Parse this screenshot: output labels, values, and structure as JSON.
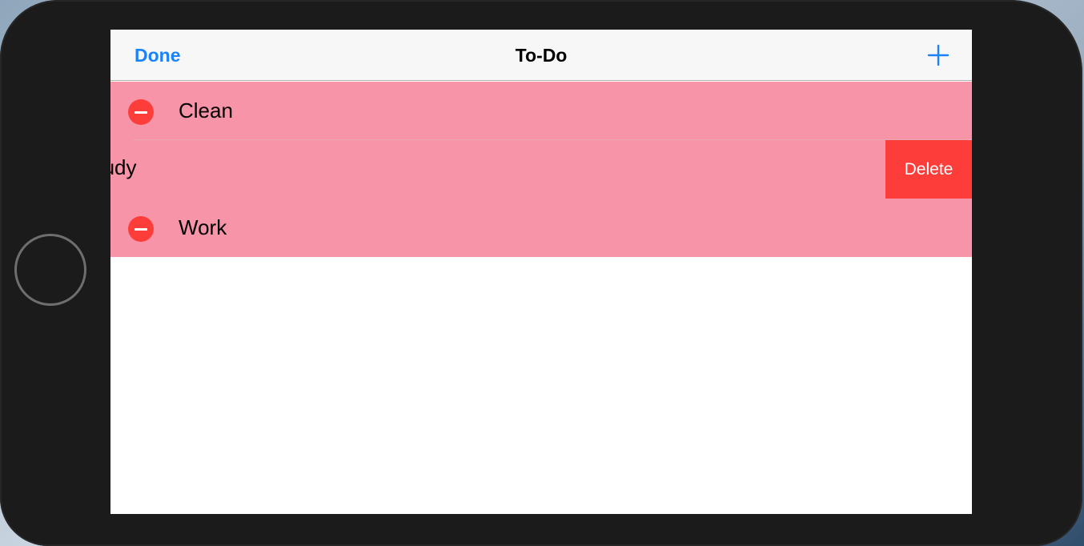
{
  "navbar": {
    "done_label": "Done",
    "title": "To-Do",
    "add_icon": "plus-icon"
  },
  "rows": [
    {
      "label": "Clean",
      "editing_control": "minus-circle-icon"
    },
    {
      "label": "Study",
      "visible_label": "tudy",
      "swiped": true,
      "delete_label": "Delete"
    },
    {
      "label": "Work",
      "editing_control": "minus-circle-icon"
    }
  ],
  "colors": {
    "tint": "#1a82fb",
    "row_background": "#f794a8",
    "destructive": "#fc3d39",
    "device_bezel": "#1b1b1b"
  }
}
